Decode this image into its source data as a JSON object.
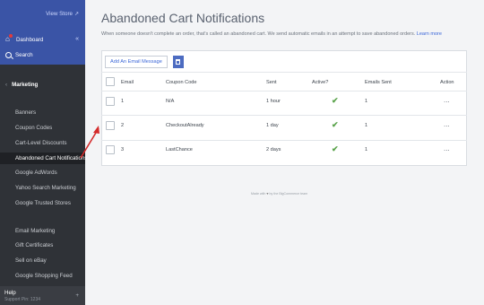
{
  "sidebar": {
    "view_store": "View Store",
    "dashboard": "Dashboard",
    "search": "Search",
    "section": "Marketing",
    "items": [
      "Banners",
      "Coupon Codes",
      "Cart-Level Discounts",
      "Abandoned Cart Notifications",
      "Google AdWords",
      "Yahoo Search Marketing",
      "Google Trusted Stores",
      "Email Marketing",
      "Gift Certificates",
      "Sell on eBay",
      "Google Shopping Feed"
    ],
    "active_item": "Abandoned Cart Notifications",
    "help": "Help",
    "support_pin": "Support Pin: 1234"
  },
  "page": {
    "title": "Abandoned Cart Notifications",
    "subtitle": "When someone doesn't complete an order, that's called an abandoned cart. We send automatic emails in an attempt to save abandoned orders.",
    "learn_more": "Learn more"
  },
  "toolbar": {
    "add_label": "Add An Email Message"
  },
  "table": {
    "headers": [
      "Email",
      "Coupon Code",
      "Sent",
      "Active?",
      "Emails Sent",
      "Action"
    ],
    "rows": [
      {
        "email": "1",
        "coupon": "N/A",
        "sent": "1 hour",
        "active": true,
        "emails_sent": "1",
        "action": "..."
      },
      {
        "email": "2",
        "coupon": "CheckoutAlready",
        "sent": "1 day",
        "active": true,
        "emails_sent": "1",
        "action": "..."
      },
      {
        "email": "3",
        "coupon": "LastChance",
        "sent": "2 days",
        "active": true,
        "emails_sent": "1",
        "action": "..."
      }
    ]
  },
  "footer": {
    "text_before": "Made with",
    "text_after": "by the BigCommerce team"
  },
  "colors": {
    "sidebar_bg": "#2f3237",
    "sidebar_header_bg": "#3a54a6",
    "accent_blue": "#3a66d8",
    "check_green": "#5aa34b",
    "annotation_red": "#d42a2a"
  }
}
